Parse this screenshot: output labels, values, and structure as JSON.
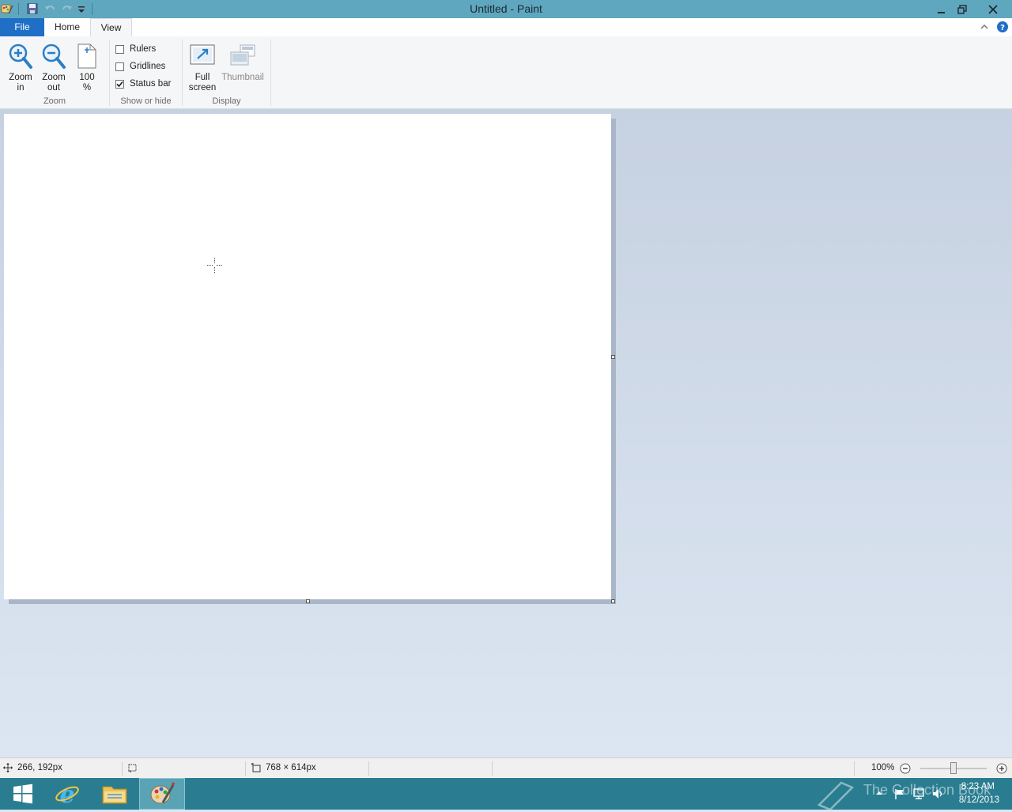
{
  "window": {
    "title": "Untitled - Paint"
  },
  "tabs": [
    {
      "label": "File"
    },
    {
      "label": "Home"
    },
    {
      "label": "View"
    }
  ],
  "ribbon": {
    "zoom_group": {
      "label": "Zoom",
      "zoom_in": {
        "line1": "Zoom",
        "line2": "in"
      },
      "zoom_out": {
        "line1": "Zoom",
        "line2": "out"
      },
      "zoom_100": {
        "line1": "100",
        "line2": "%"
      }
    },
    "show_hide_group": {
      "label": "Show or hide",
      "rulers": {
        "label": "Rulers",
        "checked": false
      },
      "gridlines": {
        "label": "Gridlines",
        "checked": false
      },
      "status_bar": {
        "label": "Status bar",
        "checked": true
      }
    },
    "display_group": {
      "label": "Display",
      "full_screen": {
        "line1": "Full",
        "line2": "screen"
      },
      "thumbnail": {
        "line1": "Thumbnail"
      }
    }
  },
  "statusbar": {
    "cursor_position": "266, 192px",
    "selection_size": "",
    "image_size": "768 × 614px",
    "zoom_level": "100%"
  },
  "taskbar": {
    "watermark": "The Collection Book",
    "time": "8:23 AM",
    "date": "8/12/2013"
  },
  "colors": {
    "titlebar": "#5fa7bf",
    "file_tab": "#1e6fc5",
    "taskbar": "#2a7d91",
    "workspace": "#dbe5f1"
  }
}
